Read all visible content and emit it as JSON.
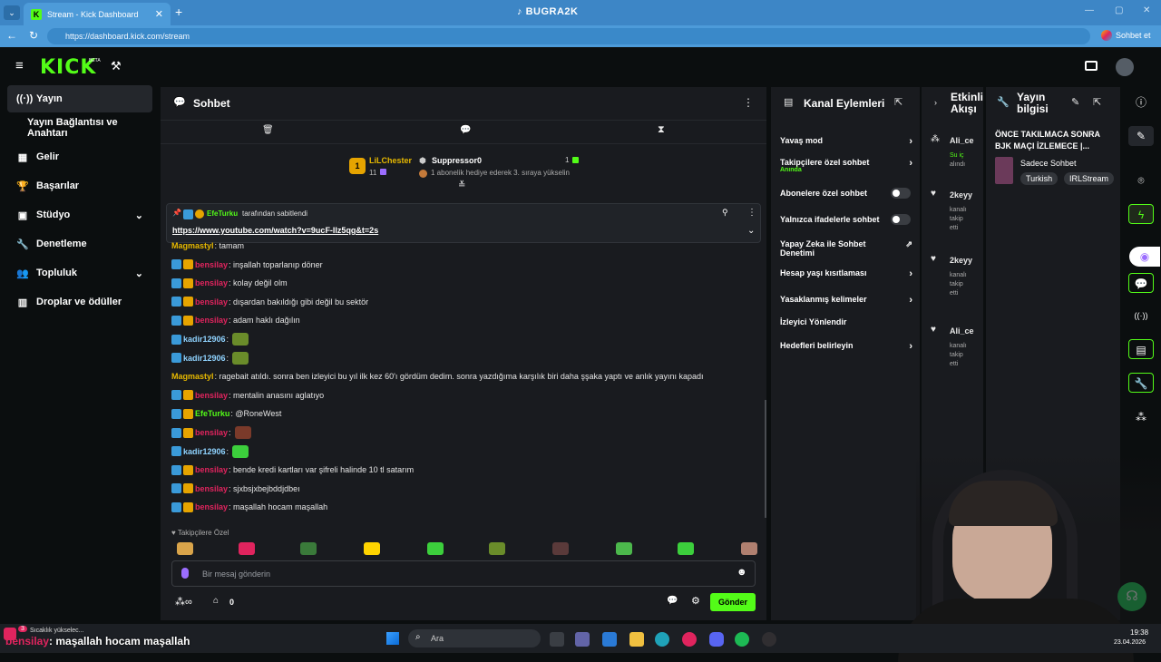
{
  "browser": {
    "tab_title": "Stream - Kick Dashboard",
    "url": "https://dashboard.kick.com/stream",
    "overlay_title": "BUGRA2K",
    "profile_label": "Sohbet et"
  },
  "header": {
    "logo": "KICK",
    "beta": "BETA"
  },
  "sidebar": {
    "items": [
      {
        "label": "Yayın",
        "icon": "broadcast-icon"
      },
      {
        "label": "Yayın Bağlantısı ve Anahtarı"
      },
      {
        "label": "Gelir",
        "icon": "revenue-icon"
      },
      {
        "label": "Başarılar",
        "icon": "trophy-icon"
      },
      {
        "label": "Stüdyo",
        "icon": "studio-icon"
      },
      {
        "label": "Denetleme",
        "icon": "wrench-icon"
      },
      {
        "label": "Topluluk",
        "icon": "community-icon"
      },
      {
        "label": "Droplar ve ödüller",
        "icon": "gift-icon"
      }
    ]
  },
  "chat": {
    "title": "Sohbet",
    "gift_leader": {
      "name": "LiLChester",
      "count": "11",
      "rank": "1"
    },
    "gift_second": {
      "name": "Suppressor0",
      "count": "1",
      "note": "1 abonelik hediye ederek 3. sıraya yükselin"
    },
    "pinned": {
      "by": "EfeTurku",
      "label": "tarafından sabitlendi",
      "link": "https://www.youtube.com/watch?v=9ucF-Ilz5qg&t=2s"
    },
    "messages": [
      {
        "user": "Magmastyl",
        "text": ": tamam",
        "color": "#e6b800",
        "badges": 0
      },
      {
        "user": "bensilay",
        "text": ": inşallah toparlanıp döner",
        "color": "#e0245e",
        "badges": 2
      },
      {
        "user": "bensilay",
        "text": ": kolay değil olm",
        "color": "#e0245e",
        "badges": 2
      },
      {
        "user": "bensilay",
        "text": ": dışardan bakıldığı gibi değil bu sektör",
        "color": "#e0245e",
        "badges": 2
      },
      {
        "user": "bensilay",
        "text": ": adam haklı dağılın",
        "color": "#e0245e",
        "badges": 2
      },
      {
        "user": "kadir12906",
        "text": ":",
        "color": "#8fd3ff",
        "badges": 1,
        "emote": "#6a8c2a"
      },
      {
        "user": "kadir12906",
        "text": ":",
        "color": "#8fd3ff",
        "badges": 1,
        "emote": "#6a8c2a"
      },
      {
        "user": "Magmastyl",
        "text": ": ragebait atıldı. sonra ben izleyici bu yıl ilk kez 60'ı gördüm dedim. sonra yazdığıma karşılık biri daha şşaka yaptı ve anlık yayını kapadı",
        "color": "#e6b800",
        "badges": 0
      },
      {
        "user": "bensilay",
        "text": ": mentalin anasını aglatıyo",
        "color": "#e0245e",
        "badges": 2
      },
      {
        "user": "EfeTurku",
        "text": ": @RoneWest",
        "color": "#53fc18",
        "badges": 2
      },
      {
        "user": "bensilay",
        "text": ":",
        "color": "#e0245e",
        "badges": 2,
        "emote": "#7a3a2a"
      },
      {
        "user": "kadir12906",
        "text": ":",
        "color": "#8fd3ff",
        "badges": 1,
        "emote": "#3ccf3c"
      },
      {
        "user": "bensilay",
        "text": ": bende kredi kartları var şifreli halinde 10 tl satarım",
        "color": "#e0245e",
        "badges": 2
      },
      {
        "user": "bensilay",
        "text": ": sjxbsjxbejbddjdbeı",
        "color": "#e0245e",
        "badges": 2
      },
      {
        "user": "bensilay",
        "text": ": maşallah hocam maşallah",
        "color": "#e0245e",
        "badges": 2
      }
    ],
    "emote_section": "Takipçilere Özel",
    "input_placeholder": "Bir mesaj gönderin",
    "viewer_count": "0",
    "send_label": "Gönder"
  },
  "actions": {
    "title": "Kanal Eylemleri",
    "items": [
      {
        "label": "Yavaş mod",
        "kind": "arrow"
      },
      {
        "label": "Takipçilere özel sohbet",
        "sub": "Anında",
        "kind": "arrow"
      },
      {
        "label": "Abonelere özel sohbet",
        "kind": "toggle"
      },
      {
        "label": "Yalnızca ifadelerle sohbet",
        "kind": "toggle"
      },
      {
        "label": "Yapay Zeka ile Sohbet Denetimi",
        "kind": "external"
      },
      {
        "label": "Hesap yaşı kısıtlaması",
        "kind": "arrow"
      },
      {
        "label": "Yasaklanmış kelimeler",
        "kind": "arrow"
      },
      {
        "label": "İzleyici Yönlendir",
        "kind": "none"
      },
      {
        "label": "Hedefleri belirleyin",
        "kind": "arrow"
      }
    ]
  },
  "events": {
    "title": "Etkinlik Akışı",
    "items": [
      {
        "name": "Ali_ce",
        "line1": "Su iç",
        "line2": "alındı"
      },
      {
        "name": "2keyy",
        "line1": "kanalı",
        "line2": "takip",
        "line3": "etti"
      },
      {
        "name": "2keyy",
        "line1": "kanalı",
        "line2": "takip",
        "line3": "etti"
      },
      {
        "name": "Ali_ce",
        "line1": "kanalı",
        "line2": "takip",
        "line3": "etti"
      }
    ]
  },
  "info": {
    "title": "Yayın bilgisi",
    "stream_title": "ÖNCE TAKILMACA SONRA BJK MAÇI İZLEMECE |...",
    "category": "Sadece Sohbet",
    "tags": [
      "Turkish",
      "IRLStream"
    ]
  },
  "taskbar": {
    "search": "Ara",
    "time": "19:38",
    "date": "23.04.2026",
    "toast_small": "Sıcaklık yükselec...",
    "toast_badge": "3"
  },
  "overlay": {
    "user": "bensilay",
    "text": ": maşallah hocam maşallah"
  }
}
